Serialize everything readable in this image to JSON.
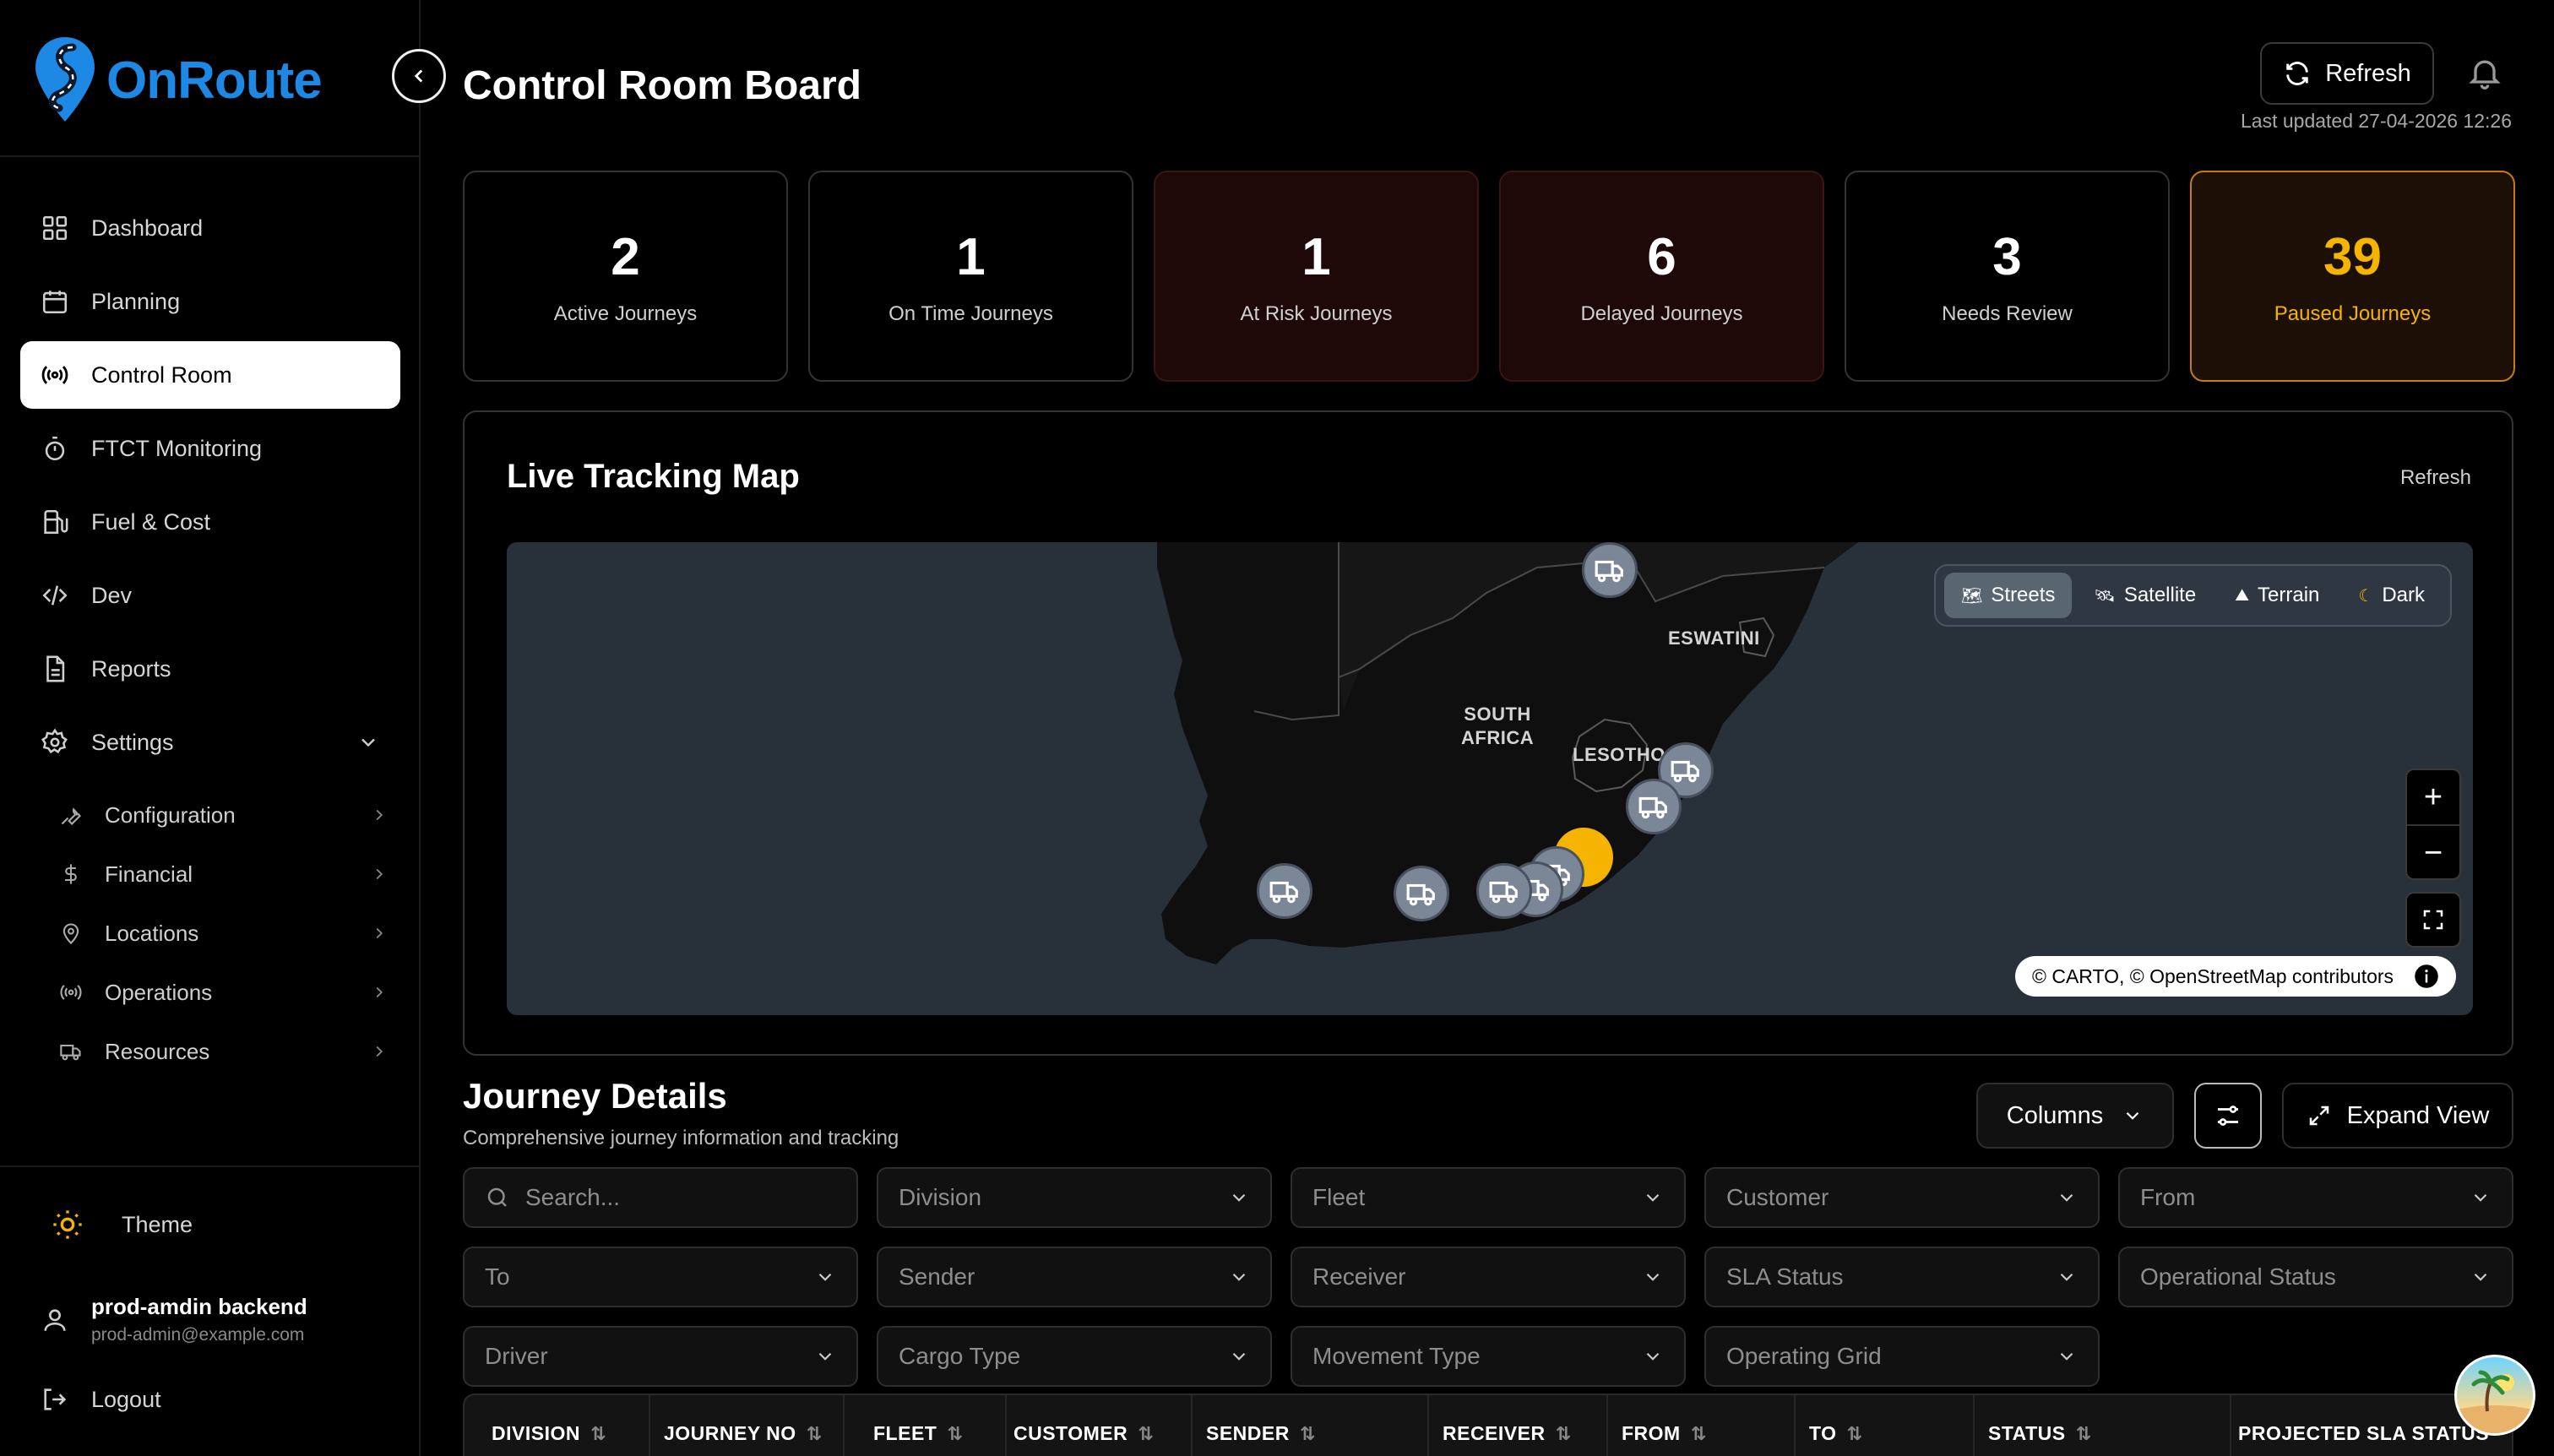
{
  "brand": {
    "name": "OnRoute",
    "color": "#1e88e5"
  },
  "header": {
    "title": "Control Room Board",
    "refresh_label": "Refresh",
    "last_updated": "Last updated 27-04-2026 12:26"
  },
  "sidebar": {
    "items": [
      {
        "label": "Dashboard",
        "icon": "grid-icon"
      },
      {
        "label": "Planning",
        "icon": "calendar-icon"
      },
      {
        "label": "Control Room",
        "icon": "broadcast-icon",
        "active": true
      },
      {
        "label": "FTCT Monitoring",
        "icon": "timer-icon"
      },
      {
        "label": "Fuel & Cost",
        "icon": "fuel-icon"
      },
      {
        "label": "Dev",
        "icon": "code-icon"
      },
      {
        "label": "Reports",
        "icon": "document-icon"
      },
      {
        "label": "Settings",
        "icon": "gear-icon",
        "expanded": true
      }
    ],
    "sub_items": [
      {
        "label": "Configuration",
        "icon": "wrench-icon"
      },
      {
        "label": "Financial",
        "icon": "dollar-icon"
      },
      {
        "label": "Locations",
        "icon": "pin-icon"
      },
      {
        "label": "Operations",
        "icon": "broadcast-icon"
      },
      {
        "label": "Resources",
        "icon": "truck-icon"
      }
    ],
    "theme_label": "Theme",
    "user": {
      "name": "prod-amdin backend",
      "email": "prod-admin@example.com"
    },
    "logout_label": "Logout"
  },
  "stats": [
    {
      "value": "2",
      "label": "Active Journeys",
      "variant": "default"
    },
    {
      "value": "1",
      "label": "On Time Journeys",
      "variant": "default"
    },
    {
      "value": "1",
      "label": "At Risk Journeys",
      "variant": "risk"
    },
    {
      "value": "6",
      "label": "Delayed Journeys",
      "variant": "risk"
    },
    {
      "value": "3",
      "label": "Needs Review",
      "variant": "default"
    },
    {
      "value": "39",
      "label": "Paused Journeys",
      "variant": "paused",
      "color": "#f5b400"
    }
  ],
  "map": {
    "title": "Live Tracking Map",
    "refresh_label": "Refresh",
    "layers": [
      {
        "label": "Streets",
        "icon": "🗺",
        "active": true
      },
      {
        "label": "Satellite",
        "icon": "🛰",
        "active": false
      },
      {
        "label": "Terrain",
        "icon": "⛰",
        "active": false
      },
      {
        "label": "Dark",
        "icon": "☾",
        "active": false
      }
    ],
    "labels": {
      "country": "SOUTH\nAFRICA",
      "lesotho": "LESOTHO",
      "eswatini": "ESWATINI"
    },
    "zoom_in": "+",
    "zoom_out": "−",
    "attribution": "© CARTO, © OpenStreetMap contributors",
    "water_color": "#283039",
    "land_color": "#0f0f0f",
    "marker_color": "#7b8696",
    "cluster_color": "#f5b400"
  },
  "journey_details": {
    "title": "Journey Details",
    "subtitle": "Comprehensive journey information and tracking",
    "columns_label": "Columns",
    "expand_label": "Expand View",
    "search_placeholder": "Search...",
    "filters_row1": [
      "Division",
      "Fleet",
      "Customer",
      "From"
    ],
    "filters_row2": [
      "To",
      "Sender",
      "Receiver",
      "SLA Status",
      "Operational Status"
    ],
    "filters_row3": [
      "Driver",
      "Cargo Type",
      "Movement Type",
      "Operating Grid"
    ],
    "table_headers": [
      "DIVISION",
      "JOURNEY NO",
      "FLEET",
      "CUSTOMER",
      "SENDER",
      "RECEIVER",
      "FROM",
      "TO",
      "STATUS",
      "PROJECTED SLA STATUS"
    ]
  }
}
